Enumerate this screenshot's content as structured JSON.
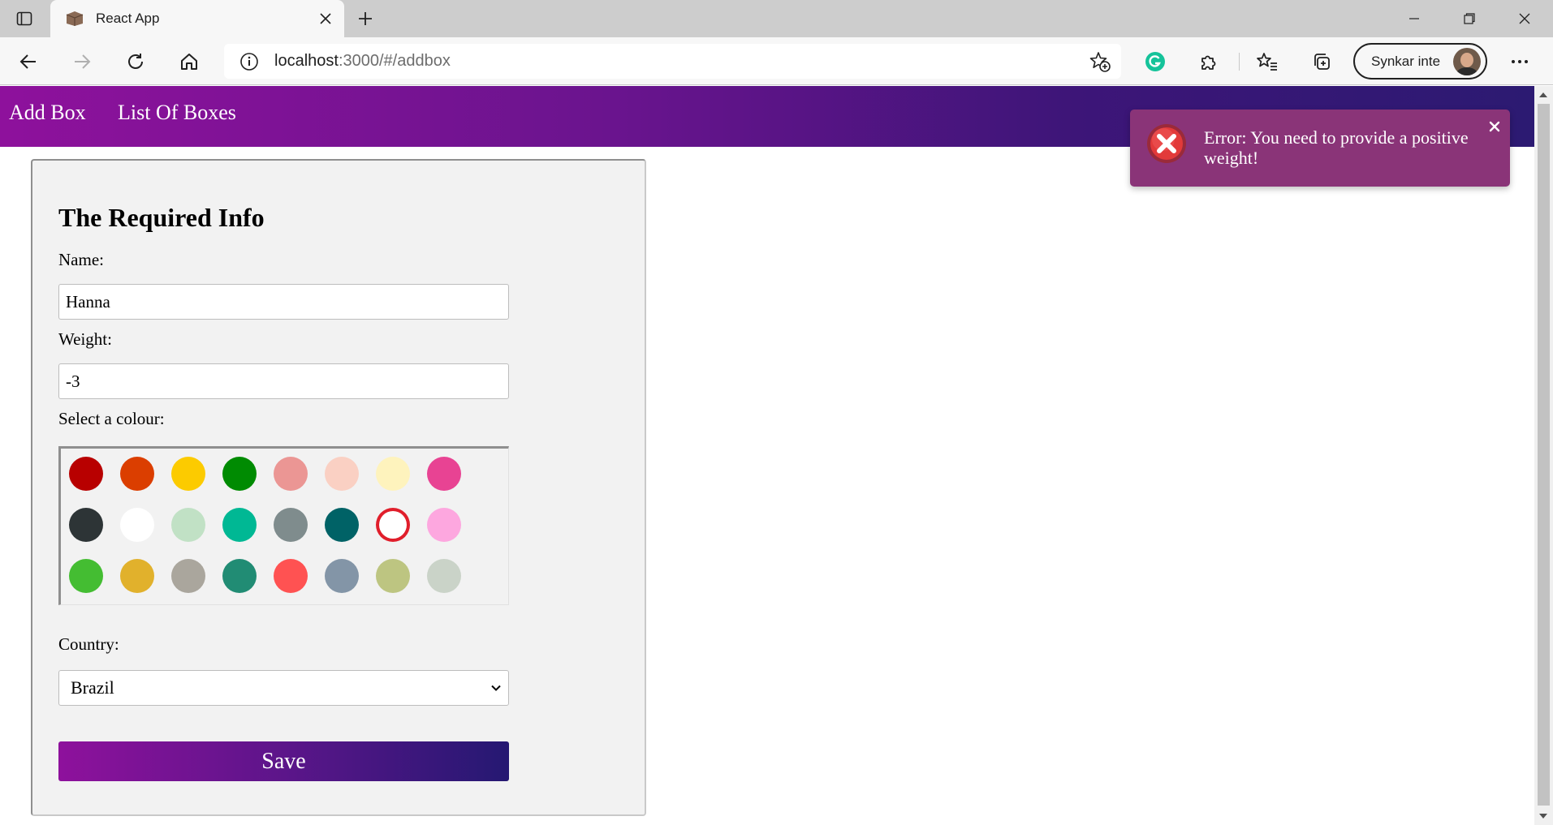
{
  "browser": {
    "tab_title": "React App",
    "url_host": "localhost",
    "url_path": ":3000/#/addbox",
    "profile_label": "Synkar inte",
    "icons": {
      "tab_actions": "tab-actions-icon",
      "favicon": "box-favicon-icon",
      "tab_close": "close-icon",
      "new_tab": "plus-icon",
      "minimize": "minimize-icon",
      "restore": "restore-icon",
      "close_window": "close-icon",
      "back": "back-arrow-icon",
      "forward": "forward-arrow-icon",
      "refresh": "refresh-icon",
      "home": "home-icon",
      "site_info": "info-icon",
      "add_favorite": "star-plus-icon",
      "grammarly": "grammarly-icon",
      "extensions": "puzzle-icon",
      "favorites": "favorites-icon",
      "collections": "collections-icon",
      "more": "more-icon"
    }
  },
  "nav": {
    "add_box": "Add Box",
    "list_of_boxes": "List Of Boxes"
  },
  "form": {
    "heading": "The Required Info",
    "name_label": "Name:",
    "name_value": "Hanna",
    "weight_label": "Weight:",
    "weight_value": "-3",
    "colour_label": "Select a colour:",
    "colours": [
      [
        "#b80000",
        "#db3e00",
        "#fccb00",
        "#008b02",
        "#eb9694",
        "#fad0c3",
        "#fef3bd",
        "#e84393"
      ],
      [
        "#2d3436",
        "#ffffff",
        "#c1e1c5",
        "#00b894",
        "#7f8c8d",
        "#006266",
        "#ffffff",
        "#fda7df"
      ],
      [
        "#44bd32",
        "#e1b12c",
        "#aaa69d",
        "#218c74",
        "#ff5252",
        "#8395a7",
        "#bdc581",
        "#cad3c8"
      ]
    ],
    "selected_colour_index": [
      1,
      6
    ],
    "country_label": "Country:",
    "country_value": "Brazil",
    "save_label": "Save"
  },
  "toast": {
    "message": "Error: You need to provide a positive weight!",
    "icon": "error-x-icon",
    "close_icon": "close-icon"
  },
  "colors": {
    "nav_gradient_start": "#8e119c",
    "nav_gradient_end": "#2c1a72",
    "toast_bg": "#8a3478",
    "error_red": "#e01e2b"
  }
}
